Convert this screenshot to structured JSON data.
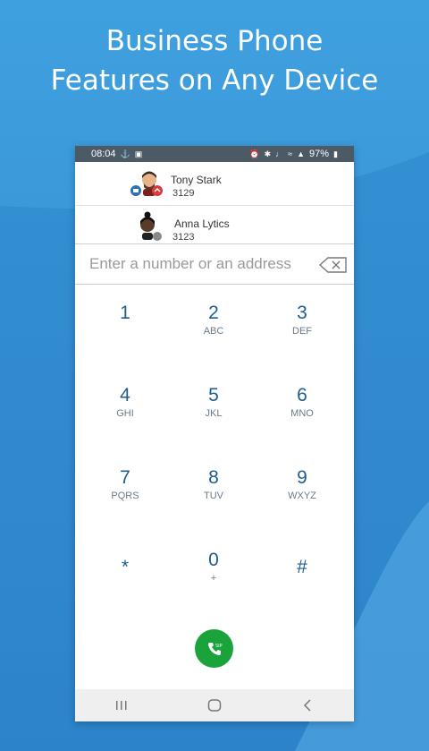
{
  "headline": {
    "line1": "Business Phone",
    "line2": "Features on Any Device"
  },
  "status_bar": {
    "time": "08:04",
    "battery": "97%"
  },
  "contacts": [
    {
      "name": "Tony Stark",
      "number": "3129"
    },
    {
      "name": "Anna Lytics",
      "number": "3123"
    }
  ],
  "dialer": {
    "placeholder": "Enter a number or an address",
    "keys": [
      {
        "digit": "1",
        "letters": ""
      },
      {
        "digit": "2",
        "letters": "ABC"
      },
      {
        "digit": "3",
        "letters": "DEF"
      },
      {
        "digit": "4",
        "letters": "GHI"
      },
      {
        "digit": "5",
        "letters": "JKL"
      },
      {
        "digit": "6",
        "letters": "MNO"
      },
      {
        "digit": "7",
        "letters": "PQRS"
      },
      {
        "digit": "8",
        "letters": "TUV"
      },
      {
        "digit": "9",
        "letters": "WXYZ"
      },
      {
        "digit": "*",
        "letters": ""
      },
      {
        "digit": "0",
        "letters": "+"
      },
      {
        "digit": "#",
        "letters": ""
      }
    ]
  },
  "colors": {
    "background": "#3b95d8",
    "call_button": "#1aa33a",
    "digit": "#1f5d8c"
  },
  "icons": {
    "call": "phone-sip-icon",
    "backspace": "backspace-icon",
    "nav_recents": "recents-icon",
    "nav_home": "home-icon",
    "nav_back": "back-icon"
  }
}
